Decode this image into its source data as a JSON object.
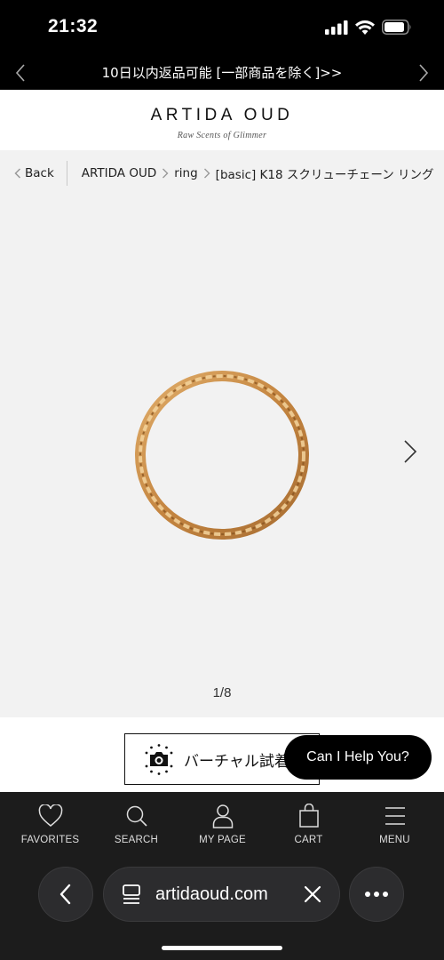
{
  "status_bar": {
    "time": "21:32"
  },
  "promo": {
    "text": "10日以内返品可能 [一部商品を除く]>>"
  },
  "header": {
    "logo": "ARTIDA OUD",
    "tagline": "Raw Scents of Glimmer"
  },
  "breadcrumb": {
    "back_label": "Back",
    "items": [
      "ARTIDA OUD",
      "ring",
      "[basic] K18 スクリューチェーン リング"
    ]
  },
  "gallery": {
    "counter": "1/8",
    "image_subject": "gold twisted chain ring"
  },
  "virtual_try_on": {
    "label": "バーチャル試着"
  },
  "chat": {
    "label": "Can I Help You?"
  },
  "tabbar": {
    "items": [
      {
        "label": "FAVORITES",
        "icon": "heart-icon"
      },
      {
        "label": "SEARCH",
        "icon": "search-icon"
      },
      {
        "label": "MY PAGE",
        "icon": "user-icon"
      },
      {
        "label": "CART",
        "icon": "bag-icon"
      },
      {
        "label": "MENU",
        "icon": "menu-icon"
      }
    ]
  },
  "browser": {
    "url": "artidaoud.com"
  },
  "colors": {
    "bar_bg": "#1c1c1c",
    "gallery_bg": "#f2f2f2",
    "ring_gold": "#c98e47"
  }
}
